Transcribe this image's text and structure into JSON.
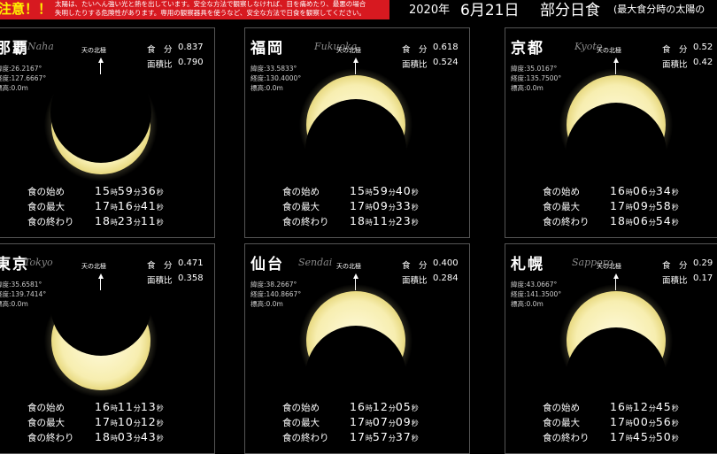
{
  "header": {
    "warning_label": "注意！！",
    "warning_line1": "太陽は、たいへん強い光と熱を出しています。安全な方法で観察しなければ、目を痛めたり、最悪の場合",
    "warning_line2": "失明したりする危険性があります。専用の観察器具を使うなど、安全な方法で日食を観察してください。",
    "year": "2020年",
    "date": "6月21日",
    "title": "部分日食",
    "subtitle": "(最大食分時の太陽の"
  },
  "labels": {
    "north": "天の北極",
    "magnitude": "食　分",
    "obscuration": "面積比",
    "begin": "食の始め",
    "max": "食の最大",
    "end": "食の終わり"
  },
  "cities": [
    {
      "name": "那覇",
      "roman": "Naha",
      "lat": "緯度:26.2167°",
      "lon": "経度:127.6667°",
      "alt": "標高:0.0m",
      "magnitude": "0.837",
      "obscuration": "0.790",
      "begin": {
        "h": "15",
        "m": "59",
        "s": "36"
      },
      "max": {
        "h": "17",
        "m": "16",
        "s": "41"
      },
      "end": {
        "h": "18",
        "m": "23",
        "s": "11"
      }
    },
    {
      "name": "福岡",
      "roman": "Fukuoka",
      "lat": "緯度:33.5833°",
      "lon": "経度:130.4000°",
      "alt": "標高:0.0m",
      "magnitude": "0.618",
      "obscuration": "0.524",
      "begin": {
        "h": "15",
        "m": "59",
        "s": "40"
      },
      "max": {
        "h": "17",
        "m": "09",
        "s": "33"
      },
      "end": {
        "h": "18",
        "m": "11",
        "s": "23"
      }
    },
    {
      "name": "京都",
      "roman": "Kyoto",
      "lat": "緯度:35.0167°",
      "lon": "経度:135.7500°",
      "alt": "標高:0.0m",
      "magnitude": "0.52",
      "obscuration": "0.42",
      "begin": {
        "h": "16",
        "m": "06",
        "s": "34"
      },
      "max": {
        "h": "17",
        "m": "09",
        "s": "58"
      },
      "end": {
        "h": "18",
        "m": "06",
        "s": "54"
      }
    },
    {
      "name": "東京",
      "roman": "Tokyo",
      "lat": "緯度:35.6581°",
      "lon": "経度:139.7414°",
      "alt": "標高:0.0m",
      "magnitude": "0.471",
      "obscuration": "0.358",
      "begin": {
        "h": "16",
        "m": "11",
        "s": "13"
      },
      "max": {
        "h": "17",
        "m": "10",
        "s": "12"
      },
      "end": {
        "h": "18",
        "m": "03",
        "s": "43"
      }
    },
    {
      "name": "仙台",
      "roman": "Sendai",
      "lat": "緯度:38.2667°",
      "lon": "経度:140.8667°",
      "alt": "標高:0.0m",
      "magnitude": "0.400",
      "obscuration": "0.284",
      "begin": {
        "h": "16",
        "m": "12",
        "s": "05"
      },
      "max": {
        "h": "17",
        "m": "07",
        "s": "09"
      },
      "end": {
        "h": "17",
        "m": "57",
        "s": "37"
      }
    },
    {
      "name": "札幌",
      "roman": "Sapporo",
      "lat": "緯度:43.0667°",
      "lon": "経度:141.3500°",
      "alt": "標高:0.0m",
      "magnitude": "0.29",
      "obscuration": "0.17",
      "begin": {
        "h": "16",
        "m": "12",
        "s": "45"
      },
      "max": {
        "h": "17",
        "m": "00",
        "s": "56"
      },
      "end": {
        "h": "17",
        "m": "45",
        "s": "50"
      }
    }
  ],
  "units": {
    "h": "時",
    "m": "分",
    "s": "秒"
  },
  "colors": {
    "sun": "#f7eeb0",
    "warning_bg": "#d71920",
    "warning_label": "#fff200",
    "panel_border": "#555555"
  }
}
